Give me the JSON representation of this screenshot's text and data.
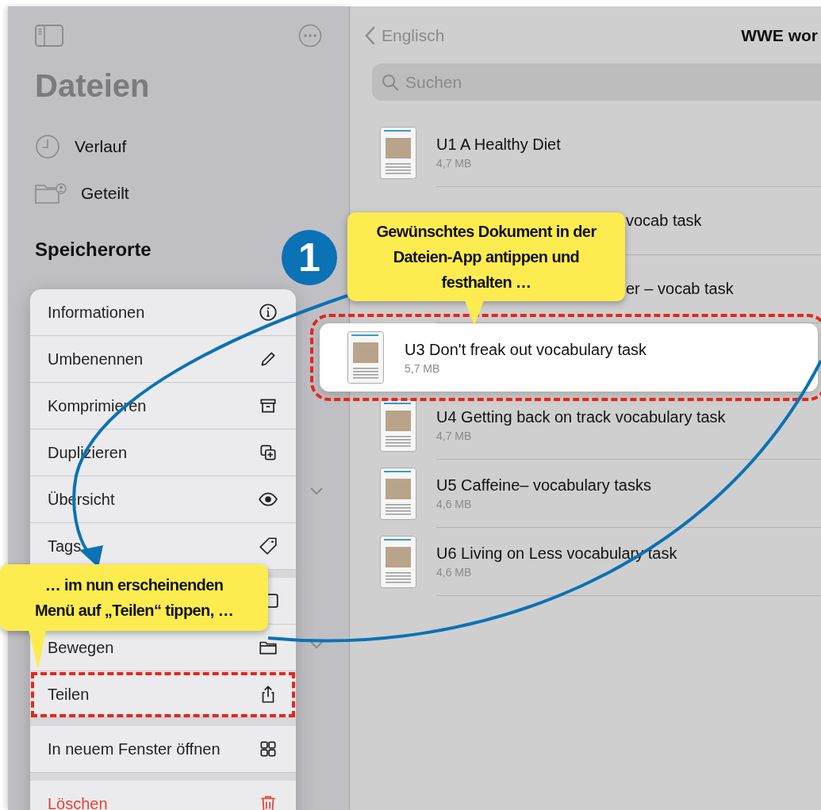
{
  "sidebar": {
    "title": "Dateien",
    "items": [
      {
        "label": "Verlauf"
      },
      {
        "label": "Geteilt"
      }
    ],
    "section": "Speicherorte"
  },
  "nav": {
    "back": "Englisch",
    "title": "WWE wor"
  },
  "search": {
    "placeholder": "Suchen"
  },
  "files": [
    {
      "name": "U1 A Healthy Diet",
      "size": "4,7 MB",
      "covered": false,
      "lifted": false,
      "highlighted": false
    },
    {
      "name": "vocab task",
      "covered": true,
      "lifted": false,
      "highlighted": false
    },
    {
      "name": "er – vocab task",
      "covered": true,
      "lifted": false,
      "highlighted": false
    },
    {
      "name": "U3 Don't freak out vocabulary task",
      "size": "5,7 MB",
      "covered": false,
      "lifted": true,
      "highlighted": true
    },
    {
      "name": "U4 Getting back on track vocabulary task",
      "size": "4,7 MB",
      "covered": false,
      "lifted": false,
      "highlighted": false
    },
    {
      "name": "U5 Caffeine– vocabulary tasks",
      "size": "4,6 MB",
      "covered": false,
      "lifted": false,
      "highlighted": false
    },
    {
      "name": "U6 Living on Less vocabulary task",
      "size": "4,6 MB",
      "covered": false,
      "lifted": false,
      "highlighted": false
    }
  ],
  "menu": {
    "groups": [
      [
        {
          "label": "Informationen",
          "covered": false,
          "destructive": false,
          "highlighted": false
        },
        {
          "label": "Umbenennen",
          "covered": false,
          "destructive": false,
          "highlighted": false
        },
        {
          "label": "Komprimieren",
          "covered": false,
          "destructive": false,
          "highlighted": false
        },
        {
          "label": "Duplizieren",
          "covered": false,
          "destructive": false,
          "highlighted": false
        },
        {
          "label": "Übersicht",
          "covered": false,
          "destructive": false,
          "highlighted": false
        },
        {
          "label": "Tags",
          "covered": false,
          "destructive": false,
          "highlighted": false
        }
      ],
      [
        {
          "covered": true,
          "destructive": false,
          "highlighted": false
        },
        {
          "label": "Bewegen",
          "covered": false,
          "destructive": false,
          "highlighted": false
        },
        {
          "label": "Teilen",
          "covered": false,
          "destructive": false,
          "highlighted": true
        }
      ],
      [
        {
          "label": "In neuem Fenster öffnen",
          "covered": false,
          "destructive": false,
          "highlighted": false
        }
      ],
      [
        {
          "label": "Löschen",
          "covered": false,
          "destructive": true,
          "highlighted": false
        }
      ]
    ]
  },
  "annotations": {
    "badge": "1",
    "callouts": [
      {
        "text": "Gewünschtes Dokument in der Dateien-App antippen und festhalten …"
      },
      {
        "text": "… im nun erscheinenden Menü auf „Teilen“ tippen, …"
      }
    ]
  }
}
